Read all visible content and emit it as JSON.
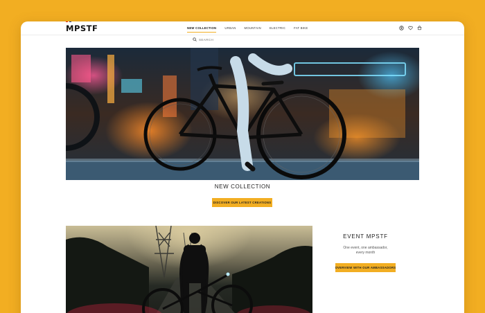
{
  "brand": {
    "logo": "MPSTF",
    "accent_colors": [
      "#e2231a",
      "#1f3a93"
    ]
  },
  "nav": {
    "items": [
      {
        "label": "NEW COLLECTION",
        "active": true
      },
      {
        "label": "URBAN",
        "active": false
      },
      {
        "label": "MOUNTAIN",
        "active": false
      },
      {
        "label": "ELECTRIC",
        "active": false
      },
      {
        "label": "FAT BIKE",
        "active": false
      }
    ]
  },
  "header_icons": [
    "user-icon",
    "heart-icon",
    "cart-icon"
  ],
  "search": {
    "placeholder": "SEARCH",
    "icon": "search-icon"
  },
  "hero": {
    "title": "NEW COLLECTION",
    "button_label": "DISCOVER OUR LATEST CREATIONS"
  },
  "event": {
    "title": "EVENT MPSTF",
    "description_line1": "One event, one ambassador,",
    "description_line2": "every month",
    "button_label": "OVERVIEW WITH OUR AMBASSADORS"
  },
  "colors": {
    "background": "#F2AE22",
    "accent": "#F2AE22",
    "window": "#FFFFFF"
  }
}
